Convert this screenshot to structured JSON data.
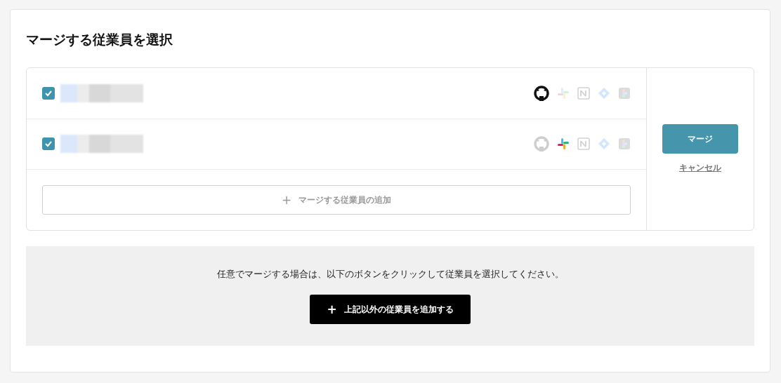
{
  "title": "マージする従業員を選択",
  "employees": [
    {
      "checked": true,
      "services": [
        {
          "kind": "github",
          "active": true
        },
        {
          "kind": "slack",
          "active": false
        },
        {
          "kind": "notion",
          "active": false
        },
        {
          "kind": "jira",
          "active": false
        },
        {
          "kind": "figma",
          "active": false
        }
      ]
    },
    {
      "checked": true,
      "services": [
        {
          "kind": "github",
          "active": false
        },
        {
          "kind": "slack",
          "active": true
        },
        {
          "kind": "notion",
          "active": false
        },
        {
          "kind": "jira",
          "active": false
        },
        {
          "kind": "figma",
          "active": false
        }
      ]
    }
  ],
  "add_employee_button": {
    "icon": "+",
    "label": "マージする従業員の追加"
  },
  "merge_button": "マージ",
  "cancel_link": "キャンセル",
  "notice": "任意でマージする場合は、以下のボタンをクリックして従業員を選択してください。",
  "add_other_button": {
    "icon": "+",
    "label": "上記以外の従業員を追加する"
  }
}
